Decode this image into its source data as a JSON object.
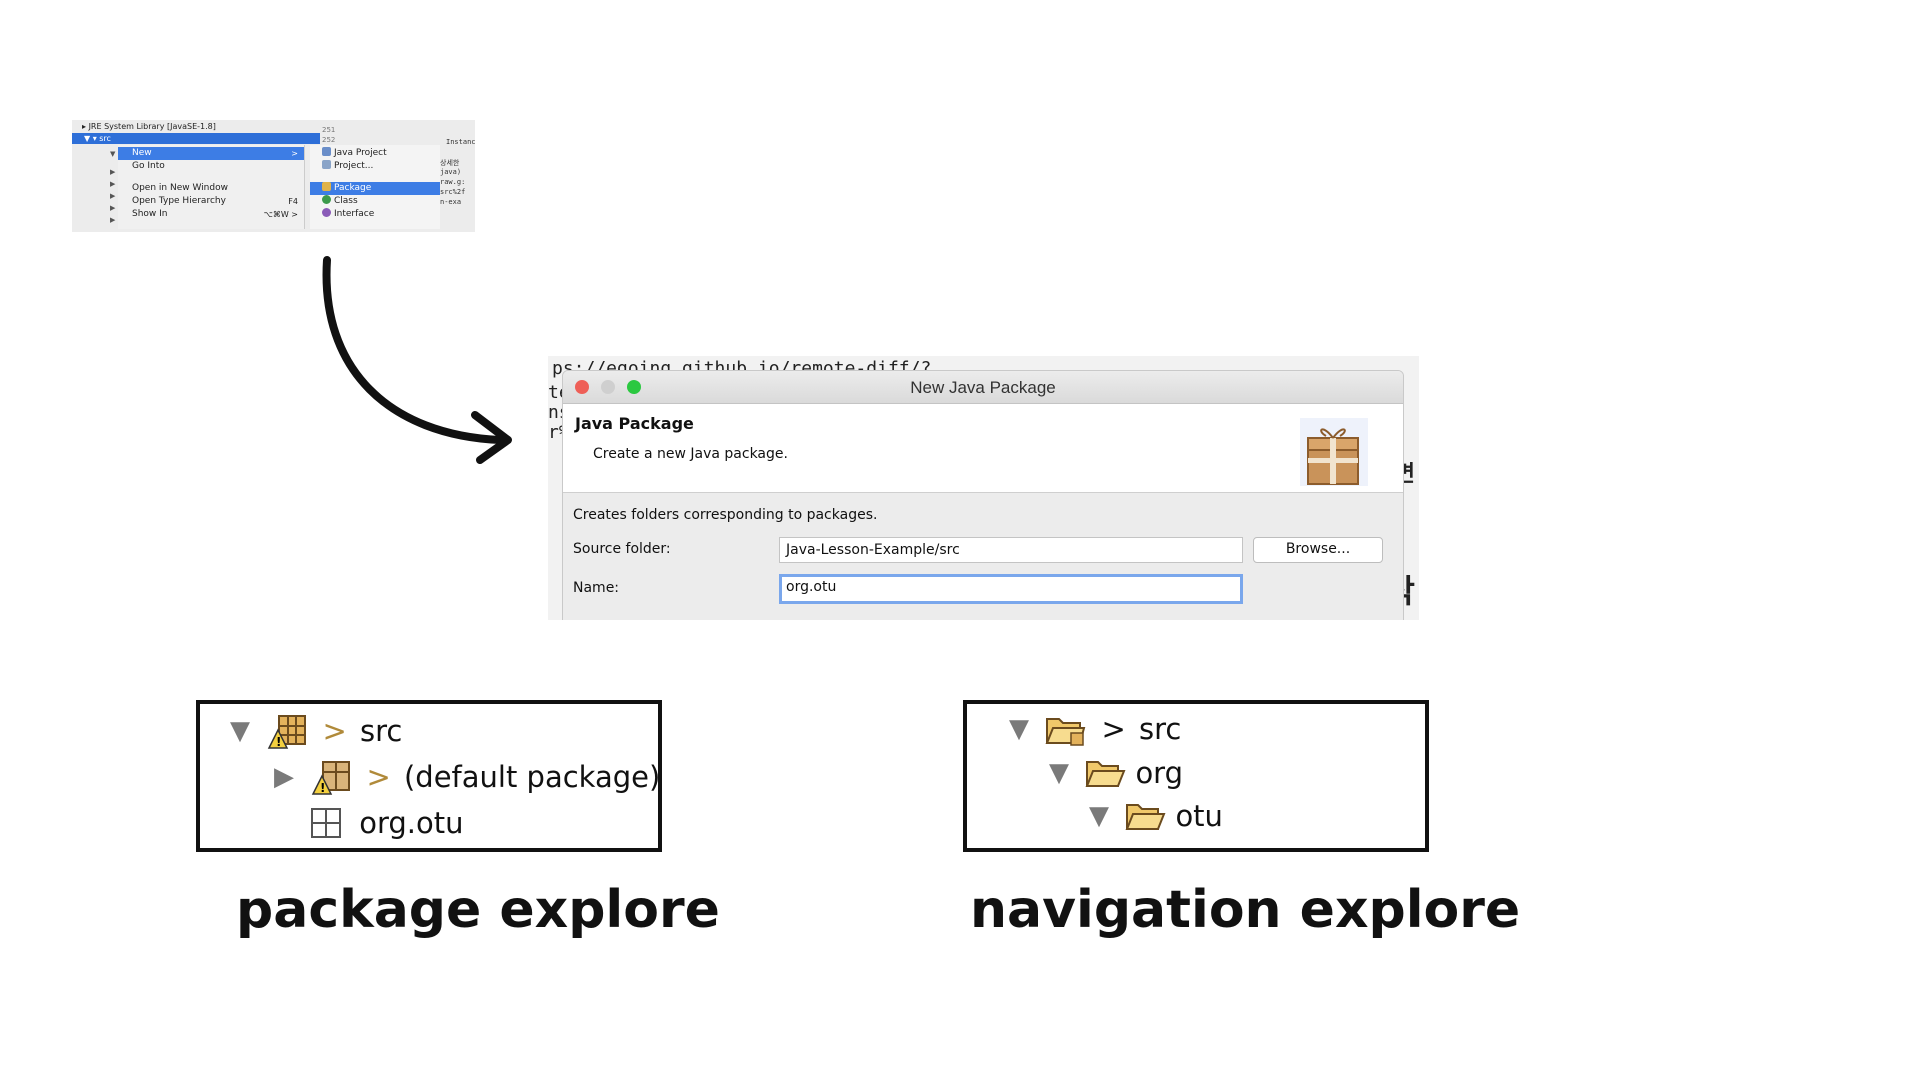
{
  "context_menu": {
    "tree_top": "JRE System Library [JavaSE-1.8]",
    "selected_row": "src",
    "line_numbers": [
      "251",
      "252"
    ],
    "menu_items": [
      {
        "label": "New",
        "shortcut": ">"
      },
      {
        "label": "Go Into",
        "shortcut": ""
      },
      {
        "label": "Open in New Window",
        "shortcut": ""
      },
      {
        "label": "Open Type Hierarchy",
        "shortcut": "F4"
      },
      {
        "label": "Show In",
        "shortcut": "⌥⌘W  >"
      }
    ],
    "submenu_items": [
      {
        "label": "Java Project"
      },
      {
        "label": "Project..."
      },
      {
        "label": "Package"
      },
      {
        "label": "Class"
      },
      {
        "label": "Interface"
      }
    ],
    "code_lines": [
      "Instance.java)(",
      "상세한",
      "java)",
      "raw.g:",
      "src%2f",
      "n-exa"
    ]
  },
  "dialog": {
    "bg_code": [
      "ps://egoing.github.io/remote-diff/?",
      "te",
      "ns",
      "r%"
    ],
    "bg_korean": [
      "면",
      "작"
    ],
    "title": "New Java Package",
    "heading": "Java Package",
    "description": "Create a new Java package.",
    "info": "Creates folders corresponding to packages.",
    "source_label": "Source folder:",
    "source_value": "Java-Lesson-Example/src",
    "browse_label": "Browse...",
    "name_label": "Name:",
    "name_value": "org.otu",
    "colors": {
      "close": "#ee5f57",
      "minimize": "#cfcfcf",
      "zoom": "#2bc840",
      "focus": "#7aa7ec"
    }
  },
  "package_explorer": {
    "rows": [
      {
        "arrow": "▼",
        "label": "src",
        "prefix": ">"
      },
      {
        "arrow": "▶",
        "label": "(default package)",
        "prefix": ">"
      },
      {
        "arrow": "",
        "label": "org.otu",
        "prefix": ""
      }
    ],
    "caption": "package explore"
  },
  "navigation_explorer": {
    "rows": [
      {
        "arrow": "▼",
        "label": "src",
        "prefix": ">"
      },
      {
        "arrow": "▼",
        "label": "org",
        "prefix": ""
      },
      {
        "arrow": "▼",
        "label": "otu",
        "prefix": ""
      }
    ],
    "caption": "navigation explore"
  }
}
